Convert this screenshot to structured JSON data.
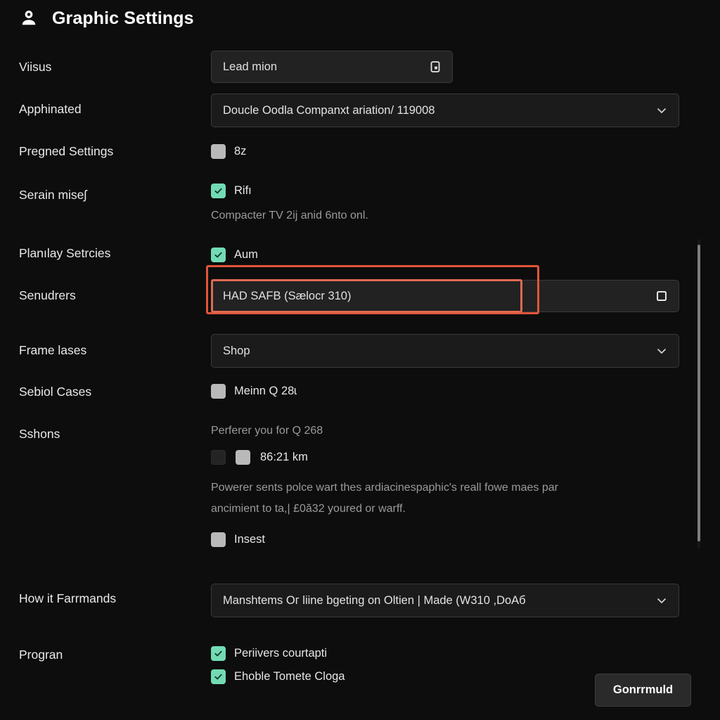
{
  "header": {
    "title": "Graphic Settings",
    "icon": "user-avatar-icon"
  },
  "rows": {
    "visus": {
      "label": "Viisus",
      "field_value": "Lead mion",
      "field_icon": "copy-box-icon"
    },
    "apphinated": {
      "label": "Apphinated",
      "select_value": "Doucle Oodla Companxt ariation/ 119008",
      "select_icon": "chevron-down-icon"
    },
    "pregned_settings": {
      "label": "Pregned Settings",
      "checkbox_label": "8z",
      "checked": false
    },
    "serain_mises": {
      "label": "Serain miseʃ",
      "checkbox_label": "Rifı",
      "checked": true,
      "description": "Compacter TV 2ĳ anid 6nto onl."
    },
    "planilay_setrcies": {
      "label": "Planılay Setrcies",
      "checkbox_label": "Aum",
      "checked": true
    },
    "senudrers": {
      "label": "Senudrers",
      "field_value": "HAD SAFB (Sælocr 310)",
      "field_icon": "square-outline-icon",
      "highlighted": true
    },
    "frame_lases": {
      "label": "Frame lases",
      "select_value": "Shop",
      "select_icon": "chevron-down-icon"
    },
    "sebiol_cases": {
      "label": "Sebiol Cases",
      "checkbox_label": "Meinn Q 28ɩ",
      "checked": false
    },
    "sshons": {
      "label": "Sshons",
      "heading": "Perferer you for Q 268",
      "distance_label": "86:21 km",
      "paragraph_line1": "Powerer sents polce wart thes ardiacinespaphic's reall fowe maes par",
      "paragraph_line2": "ancimient to ta,| £0ă32 youred or warff.",
      "insest_label": "Insest",
      "insest_checked": false
    },
    "how_it_farmands": {
      "label": "How it Farrmands",
      "select_value": "Manshtems Oг liine bgeting on Oltien | Made (W310 ,DoAб",
      "select_icon": "chevron-down-icon"
    },
    "progran": {
      "label": "Progran",
      "checkbox1_label": "Periivers courtapti",
      "checkbox1_checked": true,
      "checkbox2_label": "Ehoble Tomete Cloga",
      "checkbox2_checked": true
    }
  },
  "footer": {
    "button_label": "Gonrrmuld"
  },
  "colors": {
    "background": "#0d0d0d",
    "checkbox_accent": "#73dbb4",
    "highlight_border": "#e2543a",
    "field_bg": "#222222",
    "text_primary": "#e8e8e8",
    "text_muted": "#9a9a9a"
  }
}
